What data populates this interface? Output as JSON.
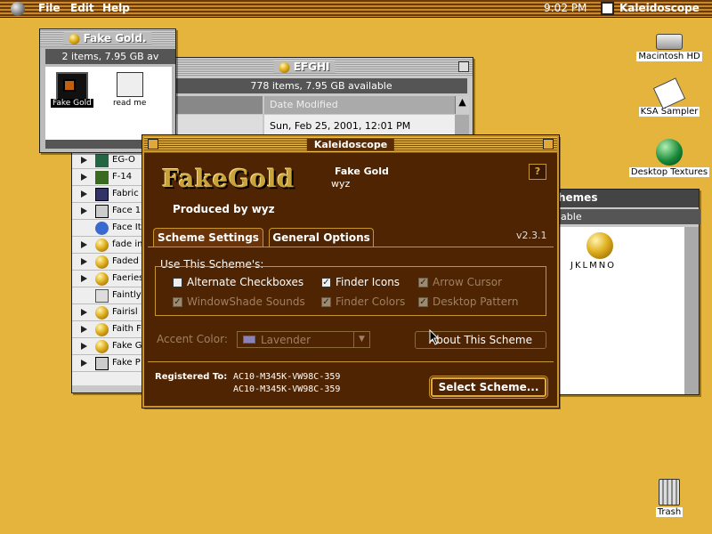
{
  "menubar": {
    "menus": [
      "File",
      "Edit",
      "Help"
    ],
    "clock": "9:02 PM",
    "app_name": "Kaleidoscope"
  },
  "finder_back": {
    "title": "EFGHI",
    "info": "778 items, 7.95 GB available",
    "date_modified_header": "Date Modified",
    "date_value": "Sun, Feb 25, 2001, 12:01 PM",
    "items": [
      "EG-O",
      "F-14",
      "Fabric",
      "Face 1",
      "Face It",
      "fade in",
      "Faded",
      "Faeries",
      "Faintly",
      "Fairisl",
      "Faith F",
      "Fake Go",
      "Fake P"
    ]
  },
  "finder_front": {
    "title": "Fake Gold.",
    "info": "2 items, 7.95 GB av",
    "items": [
      "Fake Gold",
      "read me"
    ]
  },
  "scheme_window": {
    "title_fragment": "hemes",
    "info_fragment": "lable",
    "item_label": "JKLMNO"
  },
  "kaleidoscope": {
    "title": "Kaleidoscope",
    "logo_text": "FakeGold",
    "scheme_name": "Fake Gold",
    "scheme_author": "wyz",
    "produced_by": "Produced by wyz",
    "help_symbol": "?",
    "version": "v2.3.1",
    "tabs": [
      "Scheme Settings",
      "General Options"
    ],
    "group_title": "Use This Scheme's:",
    "options": [
      {
        "label": "Alternate Checkboxes",
        "checked": false,
        "enabled": true
      },
      {
        "label": "Finder Icons",
        "checked": true,
        "enabled": true
      },
      {
        "label": "Arrow Cursor",
        "checked": true,
        "enabled": false
      },
      {
        "label": "WindowShade Sounds",
        "checked": true,
        "enabled": false
      },
      {
        "label": "Finder Colors",
        "checked": true,
        "enabled": false
      },
      {
        "label": "Desktop Pattern",
        "checked": true,
        "enabled": false
      }
    ],
    "accent_label": "Accent Color:",
    "accent_value": "Lavender",
    "about_button": "About This Scheme",
    "registered_label": "Registered To:",
    "registered_lines": [
      "AC10-M345K-VW98C-359",
      "AC10-M345K-VW98C-359"
    ],
    "select_button": "Select Scheme..."
  },
  "desktop": {
    "icons": [
      "Macintosh HD",
      "KSA Sampler",
      "Desktop Textures",
      "Trash"
    ]
  },
  "colors": {
    "desktop": "#e4b43c",
    "window_bg": "#4e2403",
    "accent_gold": "#c8952b"
  }
}
